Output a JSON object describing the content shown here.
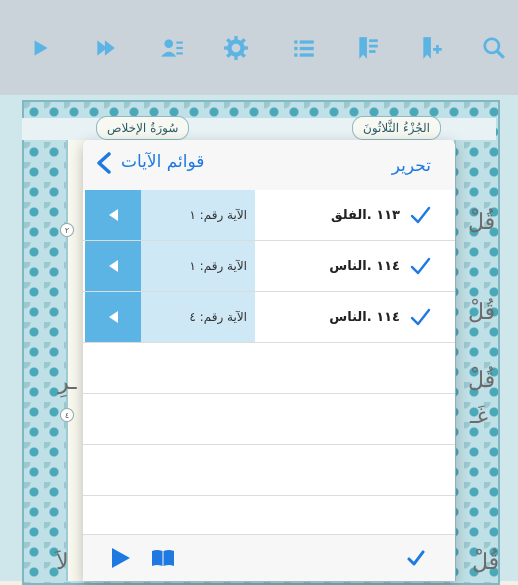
{
  "toolbar": {
    "buttons": [
      {
        "icon": "play-icon"
      },
      {
        "icon": "fast-forward-icon"
      },
      {
        "icon": "reciter-icon"
      },
      {
        "icon": "gear-icon"
      },
      {
        "icon": "list-icon"
      },
      {
        "icon": "bookmark-list-icon"
      },
      {
        "icon": "bookmark-add-icon"
      },
      {
        "icon": "search-icon"
      }
    ],
    "color": "#5bb4e4"
  },
  "page": {
    "juz_label": "الجُزْءُ الثَّلاثُونَ",
    "surah_label": "سُورَةُ الإخلاص",
    "side_glyphs": [
      "قُلْ",
      "قُلْ",
      "قُلْ",
      "ـرِ",
      "غَـ",
      "لاَ"
    ],
    "markers": [
      "٢",
      "٤"
    ]
  },
  "popover": {
    "title": "قوائم الآيات",
    "edit_label": "تحرير",
    "rows": [
      {
        "surah": "١١٣ .الفلق",
        "ayah": "الآية رقم: ١"
      },
      {
        "surah": "١١٤ .الناس",
        "ayah": "الآية رقم: ١"
      },
      {
        "surah": "١١٤ .الناس",
        "ayah": "الآية رقم: ٤"
      }
    ],
    "empty_rows": 4
  },
  "colors": {
    "accent": "#1e7ae0",
    "play_cell": "#5bb4e4",
    "ayah_cell": "#cfe8f5"
  }
}
